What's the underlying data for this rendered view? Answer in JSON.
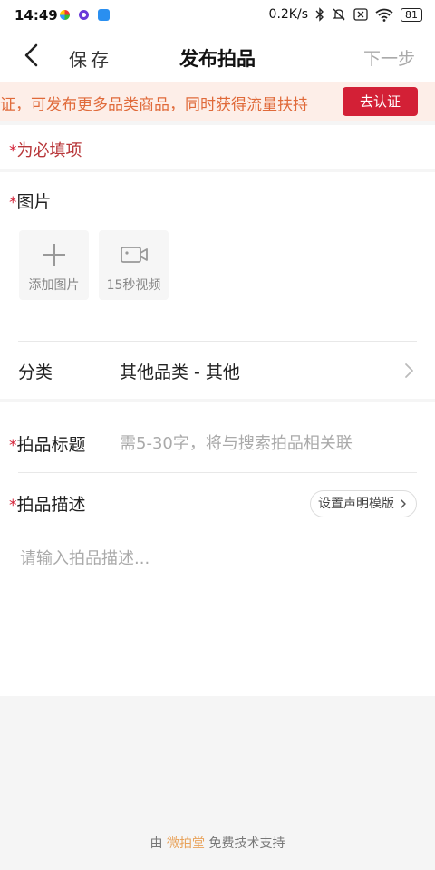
{
  "status_bar": {
    "time": "14:49",
    "network_speed": "0.2K/s",
    "battery": "81"
  },
  "nav": {
    "save_label": "保存",
    "title": "发布拍品",
    "next_label": "下一步"
  },
  "banner": {
    "text": "证，可发布更多品类商品，同时获得流量扶持",
    "button_label": "去认证"
  },
  "required_note": {
    "star": "*",
    "text": "为必填项"
  },
  "images": {
    "star": "*",
    "label": "图片",
    "add_photo_label": "添加图片",
    "add_video_label": "15秒视频"
  },
  "category": {
    "label": "分类",
    "value": "其他品类 - 其他"
  },
  "item_title": {
    "star": "*",
    "label": "拍品标题",
    "placeholder": "需5-30字，将与搜索拍品相关联"
  },
  "description": {
    "star": "*",
    "label": "拍品描述",
    "template_button": "设置声明模版",
    "placeholder": "请输入拍品描述..."
  },
  "footer": {
    "prefix": "由",
    "brand": "微拍堂",
    "suffix": "免费技术支持"
  },
  "colors": {
    "accent_red": "#d32036",
    "banner_text": "#e06a3a",
    "banner_bg": "#fdeee8",
    "brand": "#e8a25a"
  }
}
